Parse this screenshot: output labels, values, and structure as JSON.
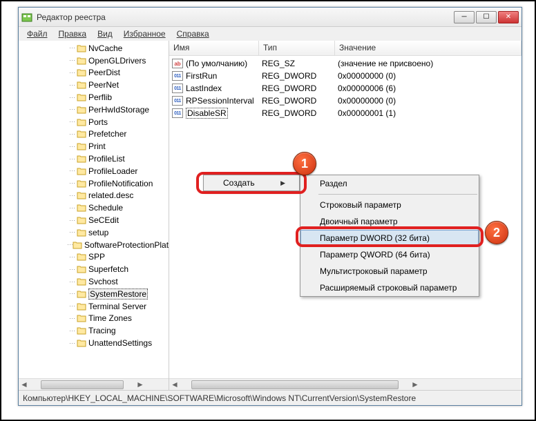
{
  "window": {
    "title": "Редактор реестра"
  },
  "menubar": [
    "Файл",
    "Правка",
    "Вид",
    "Избранное",
    "Справка"
  ],
  "tree": {
    "items": [
      "NvCache",
      "OpenGLDrivers",
      "PeerDist",
      "PeerNet",
      "Perflib",
      "PerHwIdStorage",
      "Ports",
      "Prefetcher",
      "Print",
      "ProfileList",
      "ProfileLoader",
      "ProfileNotification",
      "related.desc",
      "Schedule",
      "SeCEdit",
      "setup",
      "SoftwareProtectionPlatform",
      "SPP",
      "Superfetch",
      "Svchost",
      "SystemRestore",
      "Terminal Server",
      "Time Zones",
      "Tracing",
      "UnattendSettings"
    ],
    "selected": "SystemRestore"
  },
  "columns": {
    "name": "Имя",
    "type": "Тип",
    "value": "Значение"
  },
  "rows": [
    {
      "icon": "str",
      "name": "(По умолчанию)",
      "type": "REG_SZ",
      "value": "(значение не присвоено)"
    },
    {
      "icon": "dw",
      "name": "FirstRun",
      "type": "REG_DWORD",
      "value": "0x00000000 (0)"
    },
    {
      "icon": "dw",
      "name": "LastIndex",
      "type": "REG_DWORD",
      "value": "0x00000006 (6)"
    },
    {
      "icon": "dw",
      "name": "RPSessionInterval",
      "type": "REG_DWORD",
      "value": "0x00000000 (0)"
    },
    {
      "icon": "dw",
      "name": "DisableSR",
      "type": "REG_DWORD",
      "value": "0x00000001 (1)",
      "selected": true
    }
  ],
  "context_menu": {
    "create": "Создать"
  },
  "submenu": [
    "Раздел",
    "-",
    "Строковый параметр",
    "Двоичный параметр",
    "Параметр DWORD (32 бита)",
    "Параметр QWORD (64 бита)",
    "Мультистроковый параметр",
    "Расширяемый строковый параметр"
  ],
  "submenu_hover": "Параметр DWORD (32 бита)",
  "statusbar": "Компьютер\\HKEY_LOCAL_MACHINE\\SOFTWARE\\Microsoft\\Windows NT\\CurrentVersion\\SystemRestore",
  "callouts": {
    "c1": "1",
    "c2": "2"
  }
}
